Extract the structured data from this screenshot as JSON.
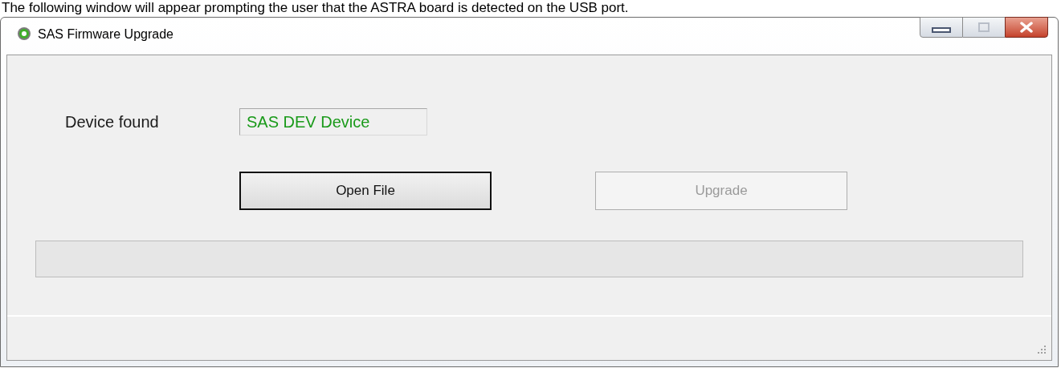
{
  "caption": "The following window will appear prompting the user that the ASTRA board is detected on the USB port.",
  "window": {
    "title": "SAS Firmware Upgrade"
  },
  "device": {
    "label": "Device found",
    "value": "SAS DEV Device"
  },
  "buttons": [
    {
      "label": "Open File",
      "disabled": false,
      "default": true
    },
    {
      "label": "Upgrade",
      "disabled": true,
      "default": false
    }
  ],
  "progress": {
    "level": 0
  }
}
